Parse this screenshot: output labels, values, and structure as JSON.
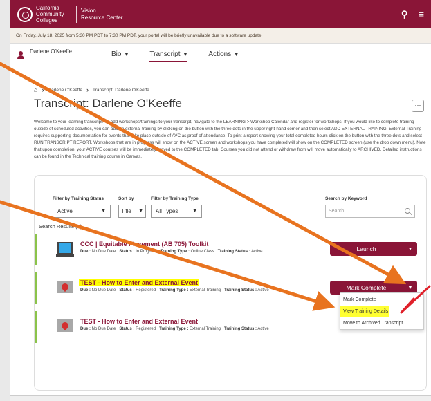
{
  "header": {
    "org_line1": "California",
    "org_line2": "Community",
    "org_line3": "Colleges",
    "product_line1": "Vision",
    "product_line2": "Resource Center",
    "search_icon": "search-icon",
    "menu_icon": "hamburger-menu-icon"
  },
  "notice": "On Friday, July 18, 2025 from 5:30 PM PDT to 7:30 PM PDT, your portal will be briefly unavailable due to a software update.",
  "user": {
    "name": "Darlene O'Keeffe",
    "icon": "user-icon"
  },
  "nav": [
    {
      "label": "Bio",
      "active": false
    },
    {
      "label": "Transcript",
      "active": true
    },
    {
      "label": "Actions",
      "active": false
    }
  ],
  "breadcrumb": {
    "item1": "Darlene O'Keeffe",
    "item2": "Transcript: Darlene O'Keeffe"
  },
  "page_title": "Transcript: Darlene O'Keeffe",
  "more_label": "···",
  "description": "Welcome to your learning transcript! To add workshops/trainings to your transcript, navigate to the LEARNING > Workshop Calendar and register for workshops. If you would like to complete training outside of scheduled activities, you can add an external training by clicking on the button with the three dots in the upper right-hand corner and then select ADD EXTERNAL TRAINING. External Training requires supporting documentation for events that take place outside of AVC as proof of attendance. To print a report showing your total completed hours click on the button with the three dots and select RUN TRANSCRIPT REPORT. Workshops that are in progress will show on the ACTIVE screen and workshops you have completed will show on the COMPLETED screen (use the drop down menu). Note that upon completion, your ACTIVE courses will be immediately moved to the COMPLETED tab. Courses you did not attend or withdrew from will move automatically to ARCHIVED. Detailed instructions can be found in the Technical training course in Canvas.",
  "filters": {
    "status_label": "Filter by Training Status",
    "status_value": "Active",
    "sort_label": "Sort by",
    "sort_value": "Title",
    "type_label": "Filter by Training Type",
    "type_value": "All Types",
    "keyword_label": "Search by Keyword",
    "keyword_placeholder": "Search"
  },
  "results_label": "Search Results (3)",
  "results": [
    {
      "title": "CCC | Equitable Placement (AB 705) Toolkit",
      "due_label": "Due :",
      "due": "No Due Date",
      "status_label": "Status :",
      "status": "In Progress",
      "type_label": "Training Type :",
      "type": "Online Class",
      "tstatus_label": "Training Status :",
      "tstatus": "Active",
      "action": "Launch",
      "icon": "laptop-icon"
    },
    {
      "title": "TEST - How to Enter and External Event",
      "due_label": "Due :",
      "due": "No Due Date",
      "status_label": "Status :",
      "status": "Registered",
      "type_label": "Training Type :",
      "type": "External Training",
      "tstatus_label": "Training Status :",
      "tstatus": "Active",
      "action": "Mark Complete",
      "icon": "external-event-icon"
    },
    {
      "title": "TEST - How to Enter and External Event",
      "due_label": "Due :",
      "due": "No Due Date",
      "status_label": "Status :",
      "status": "Registered",
      "type_label": "Training Type :",
      "type": "External Training",
      "tstatus_label": "Training Status :",
      "tstatus": "Active",
      "icon": "external-event-icon"
    }
  ],
  "dropdown": [
    {
      "label": "Mark Complete"
    },
    {
      "label": "View Training Details"
    },
    {
      "label": "Move to Archived Transcript"
    }
  ],
  "colors": {
    "brand": "#8a1537",
    "highlight": "#ffff00",
    "annotation_arrow": "#e8731f",
    "annotation_check": "#e0202a"
  }
}
